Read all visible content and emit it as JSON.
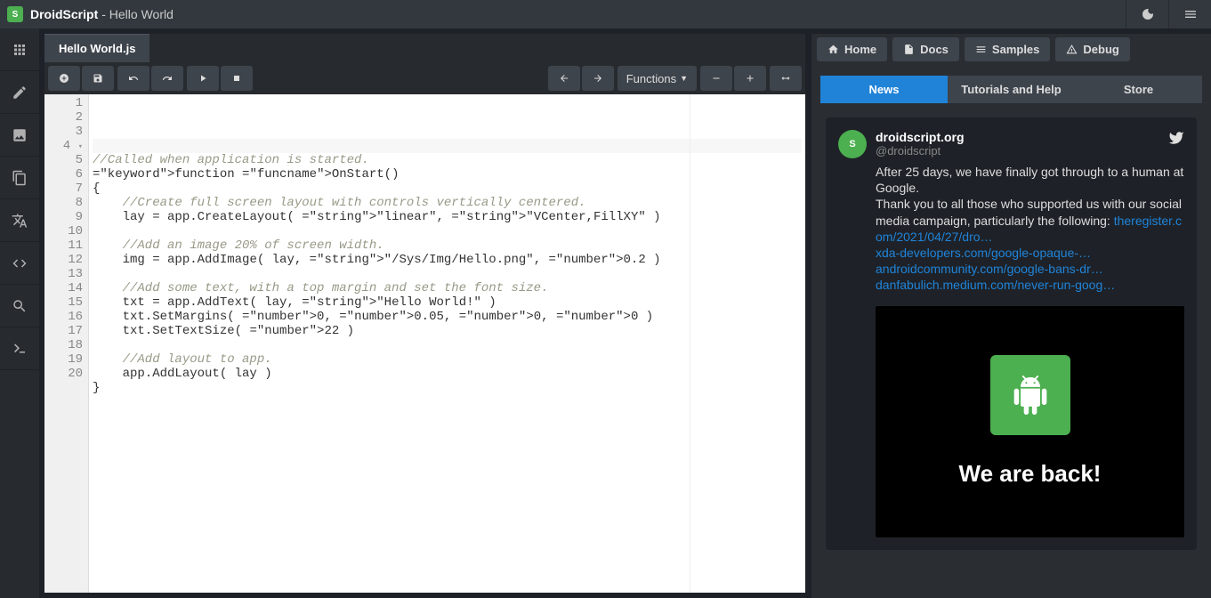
{
  "title": {
    "main": "DroidScript",
    "sub": " - Hello World"
  },
  "file_tab": "Hello World.js",
  "toolbar": {
    "functions_label": "Functions"
  },
  "code": {
    "lines": [
      "",
      "//Called when application is started.",
      "function OnStart()",
      "{",
      "    //Create full screen layout with controls vertically centered.",
      "    lay = app.CreateLayout( \"linear\", \"VCenter,FillXY\" )",
      "",
      "    //Add an image 20% of screen width.",
      "    img = app.AddImage( lay, \"/Sys/Img/Hello.png\", 0.2 )",
      "",
      "    //Add some text, with a top margin and set the font size.",
      "    txt = app.AddText( lay, \"Hello World!\" )",
      "    txt.SetMargins( 0, 0.05, 0, 0 )",
      "    txt.SetTextSize( 22 )",
      "",
      "    //Add layout to app.",
      "    app.AddLayout( lay )",
      "}",
      "",
      ""
    ]
  },
  "right_panel": {
    "tabs": [
      {
        "label": "Home",
        "icon": "home"
      },
      {
        "label": "Docs",
        "icon": "docs"
      },
      {
        "label": "Samples",
        "icon": "samples"
      },
      {
        "label": "Debug",
        "icon": "debug"
      }
    ],
    "subtabs": [
      "News",
      "Tutorials and Help",
      "Store"
    ],
    "active_subtab": 0,
    "tweet": {
      "name": "droidscript.org",
      "handle": "@droidscript",
      "body_pre": "After 25 days, we have finally got through to a human at Google.\nThank you to all those who supported us with our social media campaign, particularly the following: ",
      "links": [
        "theregister.com/2021/04/27/dro…",
        "xda-developers.com/google-opaque-…",
        "androidcommunity.com/google-bans-dr…",
        "danfabulich.medium.com/never-run-goog…"
      ],
      "image_caption": "We are back!"
    }
  }
}
